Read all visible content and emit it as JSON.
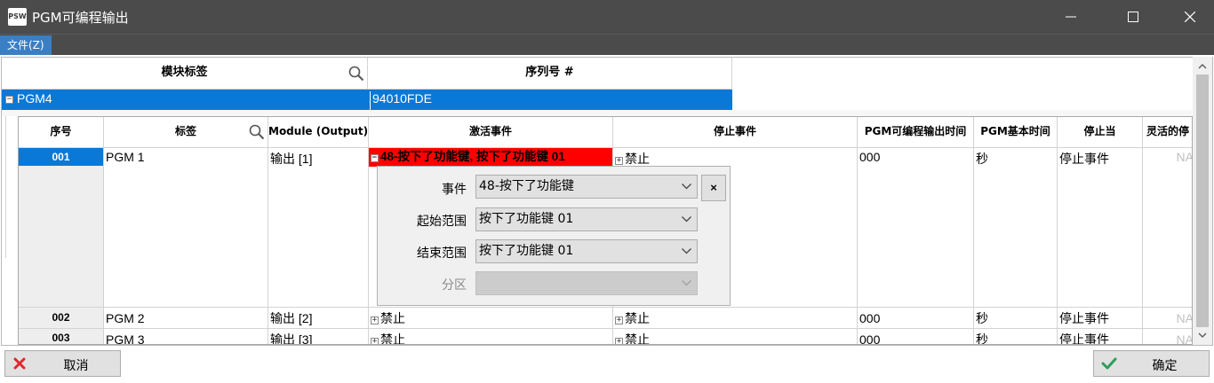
{
  "window": {
    "title": "PGM可编程输出",
    "logo_text": "PSW"
  },
  "menu": {
    "file": "文件(Z)"
  },
  "outer_grid": {
    "headers": {
      "module_label": "模块标签",
      "serial": "序列号 #"
    },
    "row": {
      "label": "PGM4",
      "serial": "94010FDE"
    }
  },
  "inner_grid": {
    "headers": {
      "seq": "序号",
      "label": "标签",
      "module": "Module (Output)",
      "activate": "激活事件",
      "stop": "停止事件",
      "pgm_time": "PGM可编程输出时间",
      "pgm_base": "PGM基本时间",
      "stop_when": "停止当",
      "flexible": "灵活的停"
    },
    "rows": [
      {
        "seq": "001",
        "label": "PGM 1",
        "module": "输出 [1]",
        "activate": "48-按下了功能键, 按下了功能键 01",
        "stop": "禁止",
        "pgm_time": "000",
        "pgm_base": "秒",
        "stop_when": "停止事件",
        "flexible": "NA"
      },
      {
        "seq": "002",
        "label": "PGM 2",
        "module": "输出 [2]",
        "activate": "禁止",
        "stop": "禁止",
        "pgm_time": "000",
        "pgm_base": "秒",
        "stop_when": "停止事件",
        "flexible": "NA"
      },
      {
        "seq": "003",
        "label": "PGM 3",
        "module": "输出 [3]",
        "activate": "禁止",
        "stop": "禁止",
        "pgm_time": "000",
        "pgm_base": "秒",
        "stop_when": "停止事件",
        "flexible": "NA"
      }
    ]
  },
  "popup": {
    "event_label": "事件",
    "event_value": "48-按下了功能键",
    "start_label": "起始范围",
    "start_value": "按下了功能键 01",
    "end_label": "结束范围",
    "end_value": "按下了功能键 01",
    "partition_label": "分区",
    "partition_value": "",
    "close": "×"
  },
  "buttons": {
    "cancel": "取消",
    "ok": "确定"
  },
  "colors": {
    "selection": "#0a78d7",
    "activate_highlight": "#ff0000",
    "titlebar": "#4b4b4b"
  }
}
